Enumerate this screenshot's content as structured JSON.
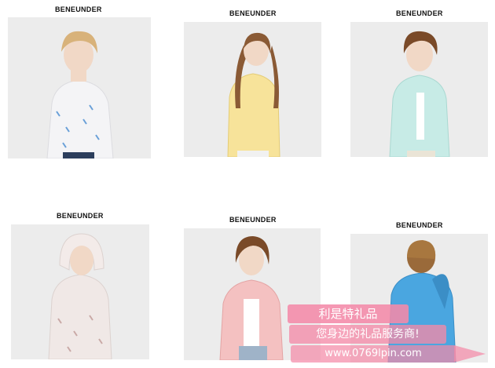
{
  "colors": {
    "page_bg": "#ffffff",
    "photo_bg": "#ececec",
    "watermark_pink": "#f48aa8"
  },
  "products": [
    {
      "brand": "BENEUNDER",
      "jacket_color": "#f4f4f6",
      "jacket_print": "blue-pattern",
      "hair": "#d8b27a"
    },
    {
      "brand": "BENEUNDER",
      "jacket_color": "#f7e39a",
      "jacket_print": "none",
      "hair": "#8a5a35"
    },
    {
      "brand": "BENEUNDER",
      "jacket_color": "#c7ebe6",
      "jacket_print": "none",
      "hair": "#7a4a28"
    },
    {
      "brand": "BENEUNDER",
      "jacket_color": "#f0e8e6",
      "jacket_print": "pattern",
      "hair": "#8a5a35"
    },
    {
      "brand": "BENEUNDER",
      "jacket_color": "#f4c1c1",
      "jacket_print": "none",
      "hair": "#7a4a28"
    },
    {
      "brand": "BENEUNDER",
      "jacket_color": "#4aa6e0",
      "jacket_print": "none",
      "hair": "#9a6a3a"
    }
  ],
  "watermark": {
    "line1": "利是特礼品",
    "line2": "您身边的礼品服务商!",
    "line3": "www.0769lpin.com"
  }
}
